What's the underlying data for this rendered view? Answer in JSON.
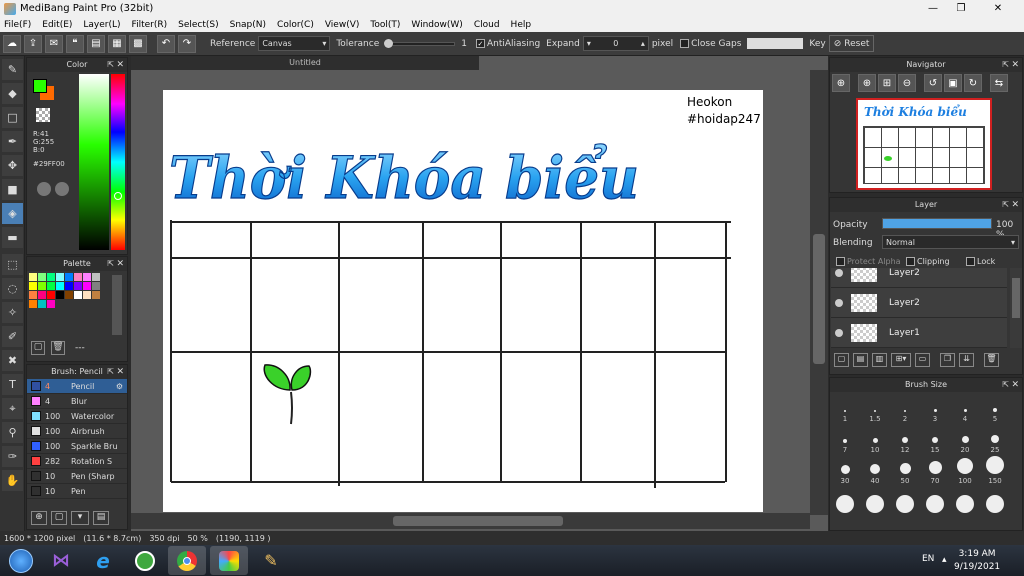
{
  "app": {
    "title": "MediBang Paint Pro (32bit)"
  },
  "window_controls": [
    "—",
    "❐",
    "✕"
  ],
  "menu": [
    "File(F)",
    "Edit(E)",
    "Layer(L)",
    "Filter(R)",
    "Select(S)",
    "Snap(N)",
    "Color(C)",
    "View(V)",
    "Tool(T)",
    "Window(W)",
    "Cloud",
    "Help"
  ],
  "toolbar": {
    "reference_label": "Reference",
    "reference_value": "Canvas",
    "tolerance_label": "Tolerance",
    "tolerance_value": "1",
    "antialias_label": "AntiAliasing",
    "expand_label": "Expand",
    "expand_value": "0",
    "expand_unit": "pixel",
    "close_gaps_label": "Close Gaps",
    "key_label": "Key",
    "reset_label": "Reset"
  },
  "color_panel": {
    "title": "Color",
    "rgb": [
      "R:41",
      "G:255",
      "B:0"
    ],
    "hex": "#29FF00",
    "primary_color": "#29ff00",
    "secondary_color": "#ff6a00"
  },
  "palette_panel": {
    "title": "Palette",
    "footer": "---",
    "swatches": [
      "#ffff80",
      "#80ff80",
      "#00ff80",
      "#80ffff",
      "#0080ff",
      "#ff80c0",
      "#ff80ff",
      "#c0c0c0",
      "#ffff00",
      "#80ff00",
      "#00ff40",
      "#00ffff",
      "#0000ff",
      "#8000ff",
      "#ff00ff",
      "#808080",
      "#ff8040",
      "#ff0080",
      "#ff0000",
      "#000000",
      "#804000",
      "#ffffff",
      "#ffe0c0",
      "#c08040",
      "#ff8000",
      "#00c0c0",
      "#ff00c0"
    ]
  },
  "brush_panel": {
    "title": "Brush: Pencil",
    "items": [
      {
        "size": "4",
        "name": "Pencil",
        "color": "#3050a0",
        "active": true
      },
      {
        "size": "4",
        "name": "Blur",
        "color": "#ff80ff"
      },
      {
        "size": "100",
        "name": "Watercolor",
        "color": "#80e0ff"
      },
      {
        "size": "100",
        "name": "Airbrush",
        "color": "#e0e0e0"
      },
      {
        "size": "100",
        "name": "Sparkle Bru",
        "color": "#3060ff"
      },
      {
        "size": "282",
        "name": "Rotation S",
        "color": "#ff4040"
      },
      {
        "size": "10",
        "name": "Pen (Sharp",
        "color": "#303030"
      },
      {
        "size": "10",
        "name": "Pen",
        "color": "#303030"
      }
    ]
  },
  "document": {
    "tab": "Untitled",
    "watermark_line1": "Heokon",
    "watermark_line2": "#hoidap247",
    "heading": "Thời Khóa biểu"
  },
  "navigator": {
    "title": "Navigator"
  },
  "layer_panel": {
    "title": "Layer",
    "opacity_label": "Opacity",
    "opacity_value": "100 %",
    "opacity": 100,
    "blending_label": "Blending",
    "blending_value": "Normal",
    "protect_alpha": "Protect Alpha",
    "clipping": "Clipping",
    "lock": "Lock",
    "layers": [
      "Layer2",
      "Layer2",
      "Layer1"
    ]
  },
  "brush_size_panel": {
    "title": "Brush Size",
    "sizes": [
      "1",
      "1.5",
      "2",
      "3",
      "4",
      "5",
      "7",
      "10",
      "12",
      "15",
      "20",
      "25",
      "30",
      "40",
      "50",
      "70",
      "100",
      "150"
    ]
  },
  "status": {
    "size": "1600 * 1200 pixel",
    "cm": "(11.6 * 8.7cm)",
    "dpi": "350 dpi",
    "zoom": "50 %",
    "coords": "(1190, 1119 )"
  },
  "taskbar": {
    "lang": "EN",
    "time": "3:19 AM",
    "date": "9/19/2021"
  }
}
